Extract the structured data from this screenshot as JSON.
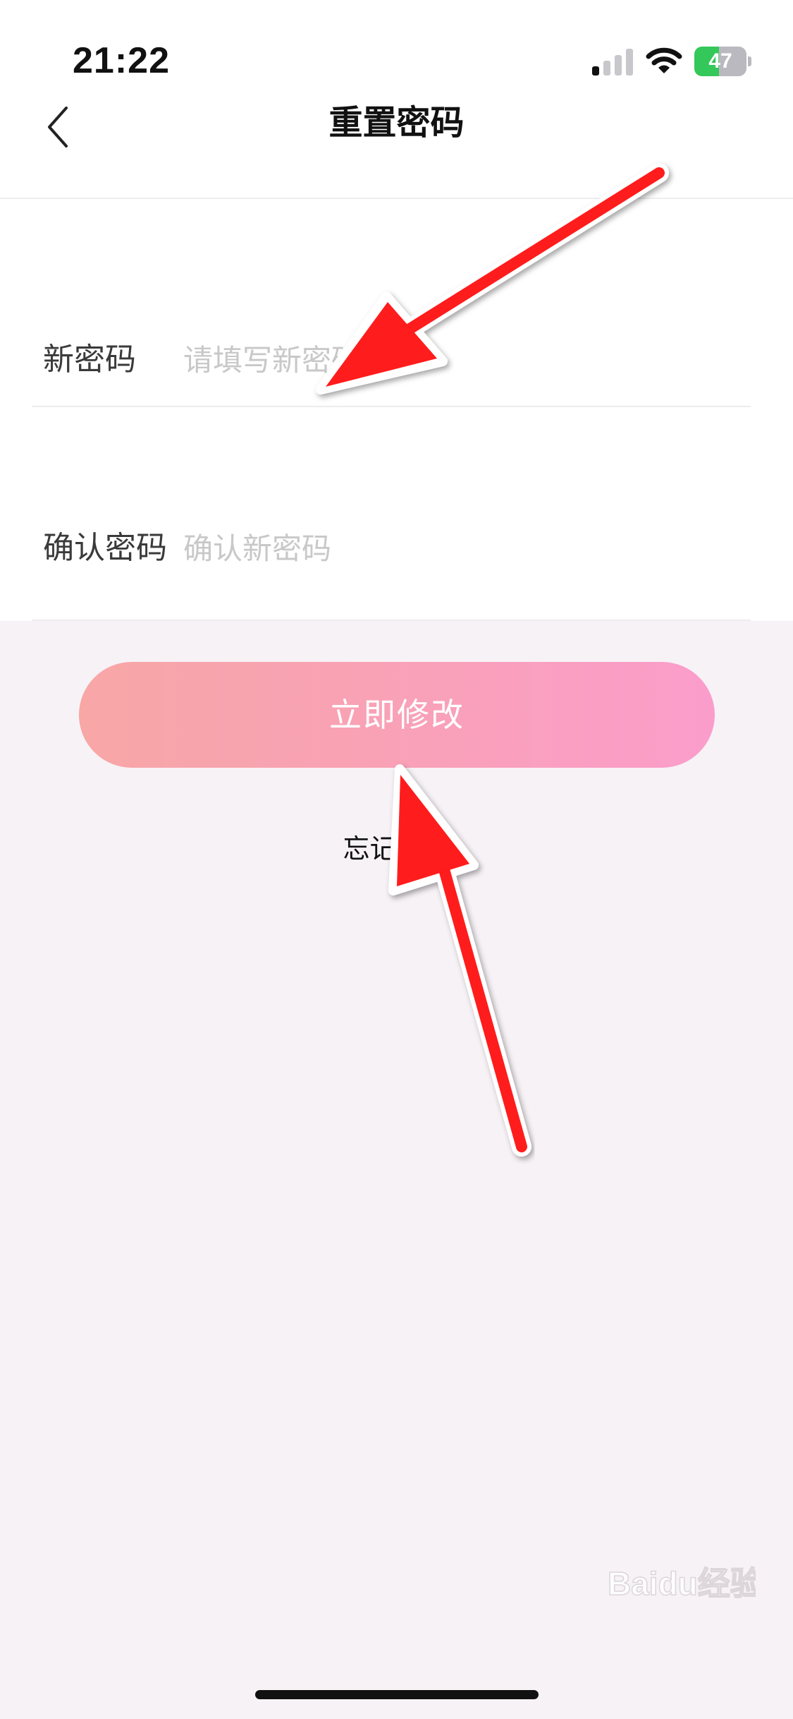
{
  "status_bar": {
    "time": "21:22",
    "battery_level": "47",
    "battery_fraction": 0.47,
    "signal_bars_active": 1,
    "signal_bars_total": 4,
    "icons": [
      "signal-icon",
      "wifi-icon",
      "battery-icon"
    ]
  },
  "nav": {
    "title": "重置密码",
    "back_icon": "chevron-left-icon"
  },
  "form": {
    "new_password": {
      "label": "新密码",
      "placeholder": "请填写新密码",
      "value": ""
    },
    "confirm_password": {
      "label": "确认密码",
      "placeholder": "确认新密码",
      "value": ""
    }
  },
  "actions": {
    "submit_label": "立即修改",
    "forgot_label": "忘记密码"
  },
  "watermark": {
    "text": "Baidu经验"
  },
  "colors": {
    "button_gradient_start": "#f8a6a6",
    "button_gradient_end": "#fb9dcb",
    "page_background": "#f7f2f6",
    "annotation_arrow": "#ff1a1a",
    "battery_green": "#34c759"
  }
}
